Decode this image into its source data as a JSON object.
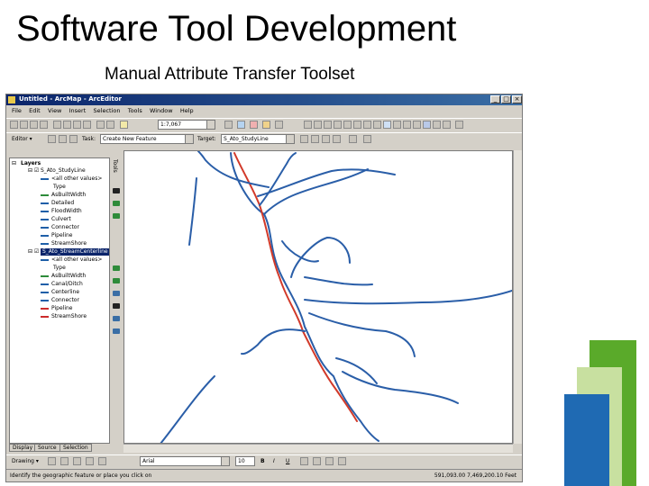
{
  "slide": {
    "title": "Software Tool Development",
    "subtitle": "Manual Attribute Transfer Toolset"
  },
  "window": {
    "title": "Untitled - ArcMap - ArcEditor",
    "controls": [
      "_",
      "□",
      "×"
    ]
  },
  "menu": [
    "File",
    "Edit",
    "View",
    "Insert",
    "Selection",
    "Tools",
    "Window",
    "Help"
  ],
  "toolbar": {
    "scale_value": "1:7,067",
    "editor_label": "Editor ▾",
    "task_label": "Task:",
    "task_value": "Create New Feature",
    "target_label": "Target:",
    "target_value": "S_Ato_StudyLine"
  },
  "toc": {
    "root": "Layers",
    "items": [
      {
        "label": "S_Ato_StudyLine",
        "type": "layer"
      },
      {
        "label": "<all other values>",
        "type": "legend",
        "color": "#1f5fa8"
      },
      {
        "label": "Type",
        "type": "heading"
      },
      {
        "label": "AsBuiltWidth",
        "type": "legend",
        "color": "#2e8b3a"
      },
      {
        "label": "Detailed",
        "type": "legend",
        "color": "#1f5fa8"
      },
      {
        "label": "FloodWidth",
        "type": "legend",
        "color": "#1f5fa8"
      },
      {
        "label": "Culvert",
        "type": "legend",
        "color": "#1f5fa8"
      },
      {
        "label": "Connector",
        "type": "legend",
        "color": "#1f5fa8"
      },
      {
        "label": "Pipeline",
        "type": "legend",
        "color": "#1f5fa8"
      },
      {
        "label": "StreamShore",
        "type": "legend",
        "color": "#1f5fa8"
      },
      {
        "label": "S_Ato_StreamCenterline",
        "type": "layer-selected"
      },
      {
        "label": "<all other values>",
        "type": "legend",
        "color": "#1f5fa8"
      },
      {
        "label": "Type",
        "type": "heading"
      },
      {
        "label": "AsBuiltWidth",
        "type": "legend",
        "color": "#2e8b3a"
      },
      {
        "label": "Canal/Ditch",
        "type": "legend",
        "color": "#1f5fa8"
      },
      {
        "label": "Centerline",
        "type": "legend",
        "color": "#1f5fa8"
      },
      {
        "label": "Connector",
        "type": "legend",
        "color": "#1f5fa8"
      },
      {
        "label": "Pipeline",
        "type": "legend",
        "color": "#cc2b2b"
      },
      {
        "label": "StreamShore",
        "type": "legend",
        "color": "#cc2b2b"
      }
    ],
    "tabs": [
      "Display",
      "Source",
      "Selection"
    ],
    "side_tools_label": "Tools"
  },
  "drawing": {
    "label": "Drawing ▾",
    "font_value": "Arial",
    "size_value": "10",
    "styles": [
      "B",
      "I",
      "U"
    ]
  },
  "status": {
    "message": "Identify the geographic feature or place you click on",
    "coordinates": "591,093.00  7,469,200.10 Feet"
  },
  "colors": {
    "stream": "#2a5ea8",
    "selected_stream": "#d23a2a",
    "logo_green_dark": "#5aaa2a",
    "logo_green_light": "#c8e0a0",
    "logo_blue": "#1f6ab3"
  }
}
